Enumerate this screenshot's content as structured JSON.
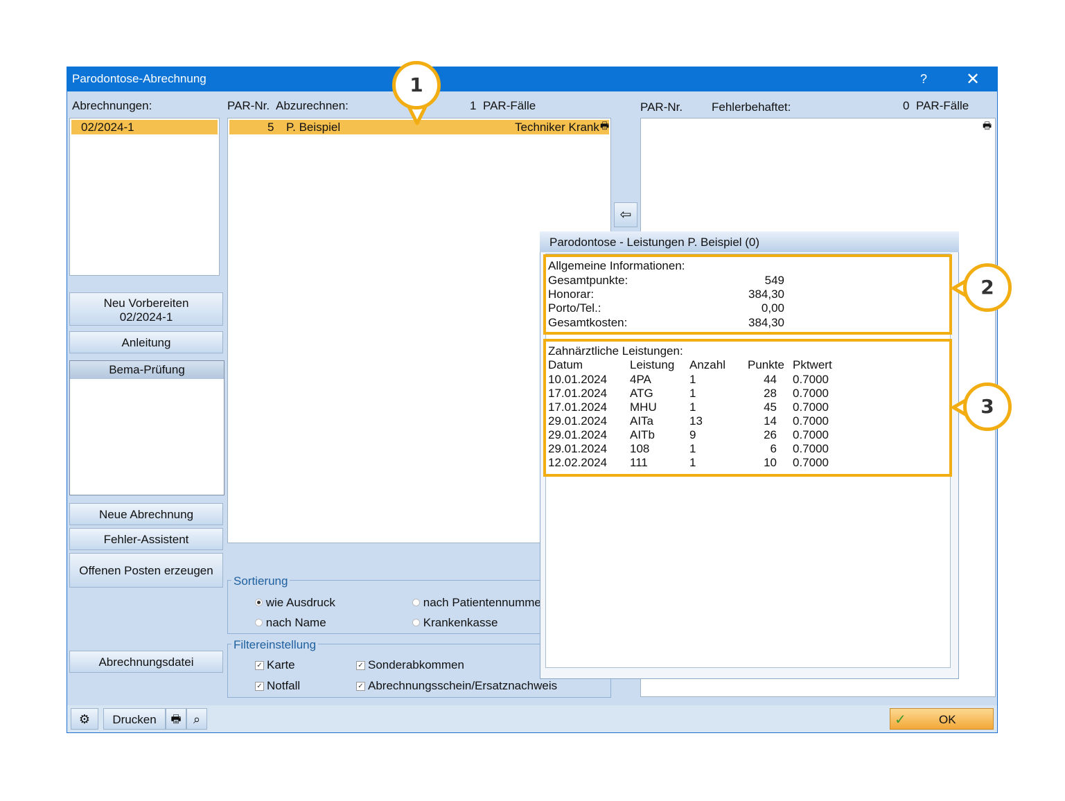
{
  "window": {
    "title": "Parodontose-Abrechnung",
    "help": "?",
    "close": "✕"
  },
  "left": {
    "abrechnungen_label": "Abrechnungen:",
    "selected_item": "02/2024-1",
    "btn_neu_vorbereiten_1": "Neu Vorbereiten",
    "btn_neu_vorbereiten_2": "02/2024-1",
    "btn_anleitung": "Anleitung",
    "bema_title": "Bema-Prüfung",
    "btn_neue_abrechnung": "Neue Abrechnung",
    "btn_fehler_assistent": "Fehler-Assistent",
    "btn_offenen_posten": "Offenen Posten erzeugen",
    "btn_abrechnungsdatei": "Abrechnungsdatei"
  },
  "middle": {
    "par_nr": "PAR-Nr.",
    "abzurechnen": "Abzurechnen:",
    "count": "1",
    "faelle": "PAR-Fälle",
    "row": {
      "nr": "5",
      "name": "P.  Beispiel",
      "kasse": "Techniker Krank"
    }
  },
  "right": {
    "par_nr": "PAR-Nr.",
    "fehler": "Fehlerbehaftet:",
    "count": "0",
    "faelle": "PAR-Fälle"
  },
  "sortierung": {
    "title": "Sortierung",
    "opt1": "wie Ausdruck",
    "opt2": "nach Patientennumme",
    "opt3": "nach Name",
    "opt4": "Krankenkasse",
    "selected": "wie Ausdruck"
  },
  "filter": {
    "title": "Filtereinstellung",
    "karte": "Karte",
    "sonder": "Sonderabkommen",
    "notfall": "Notfall",
    "schein": "Abrechnungsschein/Ersatznachweis",
    "check": "✓"
  },
  "popup": {
    "title": "Parodontose - Leistungen  P. Beispiel (0)",
    "info_title": "Allgemeine Informationen:",
    "info": [
      {
        "label": "Gesamtpunkte:",
        "value": "549"
      },
      {
        "label": "Honorar:",
        "value": "384,30"
      },
      {
        "label": "Porto/Tel.:",
        "value": "0,00"
      },
      {
        "label": "Gesamtkosten:",
        "value": "384,30"
      }
    ],
    "leistungen_title": "Zahnärztliche Leistungen:",
    "columns": [
      "Datum",
      "Leistung",
      "Anzahl",
      "Punkte",
      "Pktwert"
    ],
    "rows": [
      [
        "10.01.2024",
        "4PA",
        "1",
        "44",
        "0.7000"
      ],
      [
        "17.01.2024",
        "ATG",
        "1",
        "28",
        "0.7000"
      ],
      [
        "17.01.2024",
        "MHU",
        "1",
        "45",
        "0.7000"
      ],
      [
        "29.01.2024",
        "AITa",
        "13",
        "14",
        "0.7000"
      ],
      [
        "29.01.2024",
        "AITb",
        "9",
        "26",
        "0.7000"
      ],
      [
        "29.01.2024",
        "108",
        "1",
        "6",
        "0.7000"
      ],
      [
        "12.02.2024",
        "111",
        "1",
        "10",
        "0.7000"
      ]
    ]
  },
  "bottom": {
    "drucken": "Drucken",
    "ok": "OK"
  },
  "callouts": [
    "1",
    "2",
    "3"
  ],
  "colors": {
    "title_bar": "#0b74d6",
    "highlight": "#f2ad12",
    "selection": "#f6c04e"
  },
  "icons": [
    "gear-icon",
    "printer-icon",
    "search-icon",
    "arrow-left-icon",
    "check-icon"
  ]
}
